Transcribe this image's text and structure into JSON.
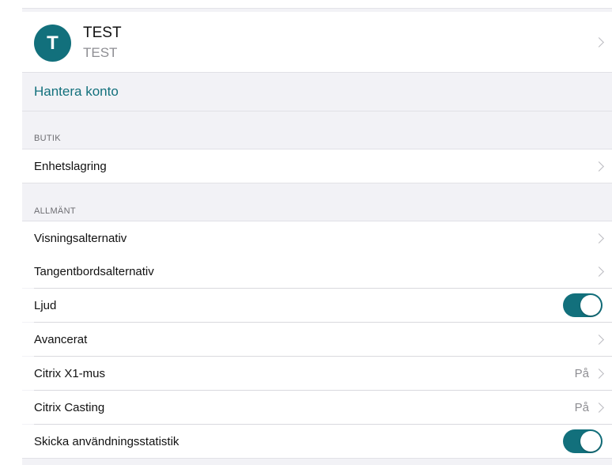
{
  "account": {
    "avatar_letter": "T",
    "name": "TEST",
    "subtitle": "TEST"
  },
  "manage_account_label": "Hantera konto",
  "store": {
    "header": "BUTIK",
    "items": [
      {
        "label": "Enhetslagring"
      }
    ]
  },
  "general": {
    "header": "ALLMÄNT",
    "items": [
      {
        "label": "Visningsalternativ"
      },
      {
        "label": "Tangentbordsalternativ"
      },
      {
        "label": "Ljud",
        "toggle_on": true
      },
      {
        "label": "Avancerat"
      },
      {
        "label": "Citrix X1-mus",
        "value": "På"
      },
      {
        "label": "Citrix Casting",
        "value": "På"
      },
      {
        "label": "Skicka användningsstatistik",
        "toggle_on": true
      }
    ]
  },
  "colors": {
    "accent": "#12707c",
    "background": "#f2f2f6"
  }
}
